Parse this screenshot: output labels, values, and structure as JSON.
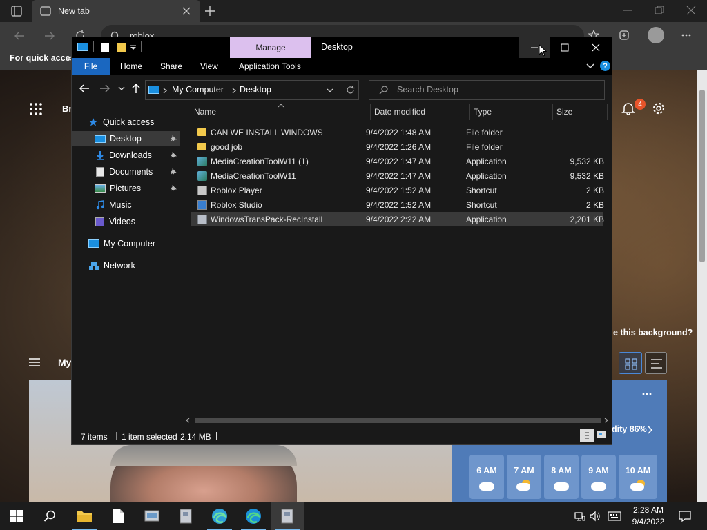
{
  "browser": {
    "tab_title": "New tab",
    "address_text": "roblox",
    "favorites_hint": "For quick access",
    "brand_partial": "Br",
    "my_feed_partial": "My",
    "background_prompt": "e this background?",
    "notification_count": "4",
    "weather": {
      "humidity": "dity 86%",
      "hours": [
        "6 AM",
        "7 AM",
        "8 AM",
        "9 AM",
        "10 AM"
      ]
    }
  },
  "explorer": {
    "manage_label": "Manage",
    "window_title": "Desktop",
    "ribbon_tabs": [
      "File",
      "Home",
      "Share",
      "View",
      "Application Tools"
    ],
    "breadcrumb": [
      "My Computer",
      "Desktop"
    ],
    "search_placeholder": "Search Desktop",
    "nav": {
      "quick_access": "Quick access",
      "pinned": [
        "Desktop",
        "Downloads",
        "Documents",
        "Pictures"
      ],
      "unpinned": [
        "Music",
        "Videos"
      ],
      "my_computer": "My Computer",
      "network": "Network"
    },
    "columns": {
      "name": "Name",
      "date": "Date modified",
      "type": "Type",
      "size": "Size"
    },
    "files": [
      {
        "name": "CAN WE INSTALL WINDOWS",
        "date": "9/4/2022 1:48 AM",
        "type": "File folder",
        "size": "",
        "icon": "folder-icon"
      },
      {
        "name": "good job",
        "date": "9/4/2022 1:26 AM",
        "type": "File folder",
        "size": "",
        "icon": "folder-icon"
      },
      {
        "name": "MediaCreationToolW11 (1)",
        "date": "9/4/2022 1:47 AM",
        "type": "Application",
        "size": "9,532 KB",
        "icon": "app-icon"
      },
      {
        "name": "MediaCreationToolW11",
        "date": "9/4/2022 1:47 AM",
        "type": "Application",
        "size": "9,532 KB",
        "icon": "app-icon"
      },
      {
        "name": "Roblox Player",
        "date": "9/4/2022 1:52 AM",
        "type": "Shortcut",
        "size": "2 KB",
        "icon": "shortcut-icon"
      },
      {
        "name": "Roblox Studio",
        "date": "9/4/2022 1:52 AM",
        "type": "Shortcut",
        "size": "2 KB",
        "icon": "shortcut-icon"
      },
      {
        "name": "WindowsTransPack-RecInstall",
        "date": "9/4/2022 2:22 AM",
        "type": "Application",
        "size": "2,201 KB",
        "icon": "package-icon"
      }
    ],
    "status": {
      "items": "7 items",
      "selected": "1 item selected",
      "size": "2.14 MB"
    }
  },
  "taskbar": {
    "time": "2:28 AM",
    "date": "9/4/2022"
  },
  "colors": {
    "manage_tab": "#dcc0ee",
    "file_tab": "#1a67c0",
    "selection": "#3a3a3a",
    "notification_badge": "#e8542a"
  }
}
